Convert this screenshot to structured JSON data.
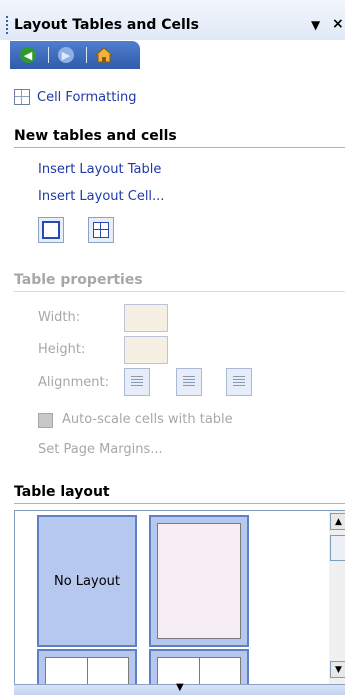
{
  "pane": {
    "title": "Layout Tables and Cells",
    "menu_icon": "▼",
    "close_icon": "×"
  },
  "navigation": {
    "back_icon": "back-arrow-icon",
    "forward_icon": "forward-arrow-icon",
    "home_icon": "home-icon"
  },
  "cell_formatting": {
    "label": "Cell Formatting"
  },
  "new_tables": {
    "header": "New tables and cells",
    "insert_table": "Insert Layout Table",
    "insert_cell": "Insert Layout Cell..."
  },
  "table_properties": {
    "header": "Table properties",
    "width_label": "Width:",
    "height_label": "Height:",
    "alignment_label": "Alignment:",
    "autoscale_label": "Auto-scale cells with table",
    "margins_label": "Set Page Margins..."
  },
  "table_layout": {
    "header": "Table layout",
    "no_layout_label": "No Layout"
  },
  "colors": {
    "accent": "#2f5cab",
    "link": "#1f3aa8",
    "disabled": "#a7a7a7"
  }
}
